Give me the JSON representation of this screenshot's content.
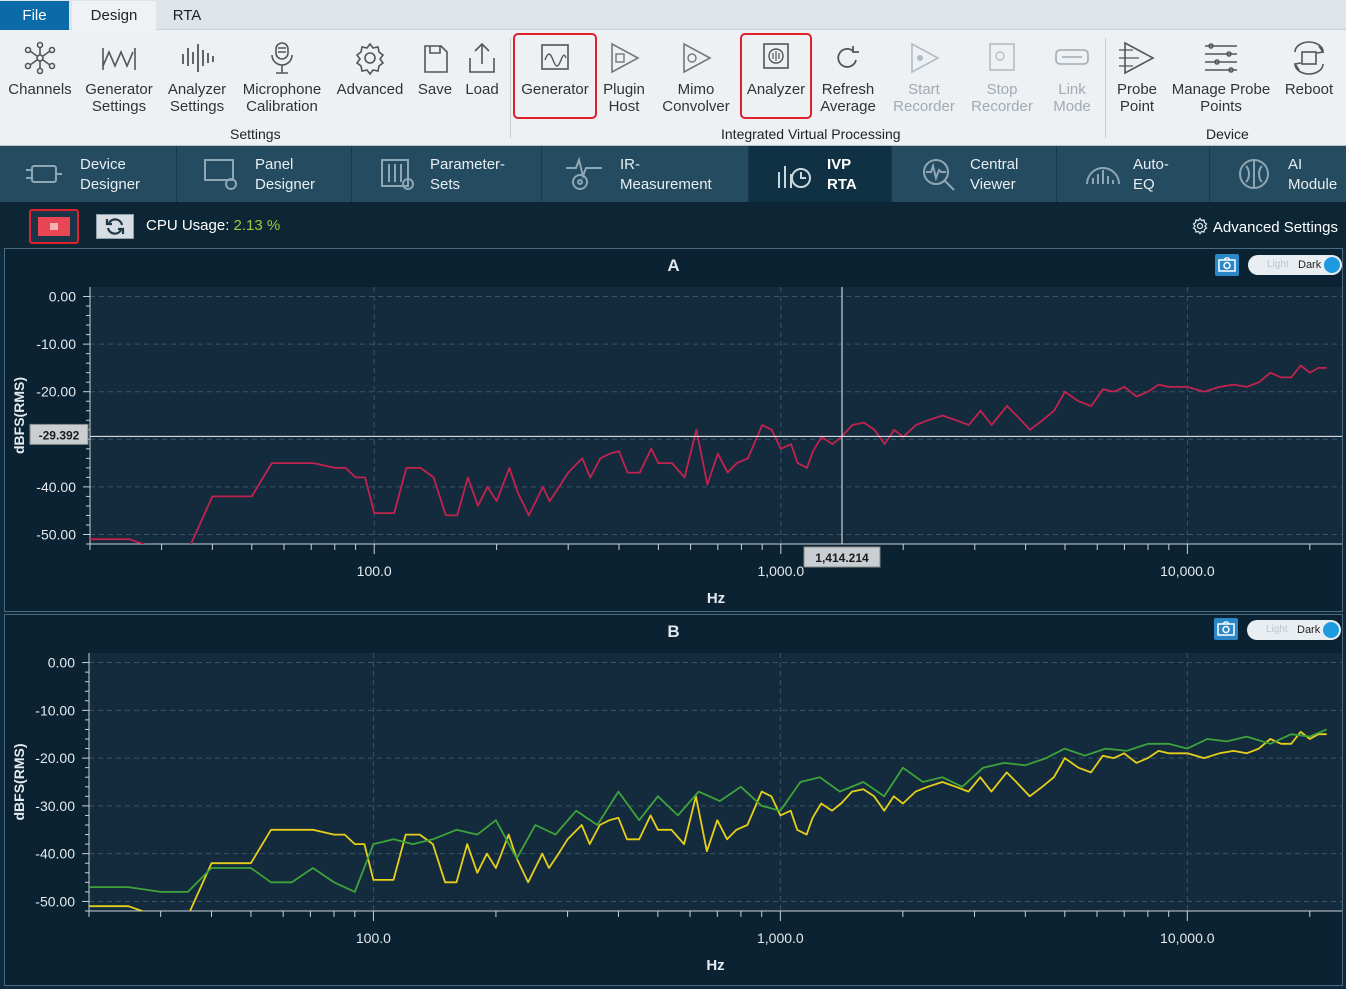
{
  "menu": {
    "tabs": [
      "File",
      "Design",
      "RTA"
    ]
  },
  "ribbon": {
    "buttons": [
      {
        "id": "channels",
        "label": "Channels"
      },
      {
        "id": "generator-settings",
        "label": "Generator\nSettings"
      },
      {
        "id": "analyzer-settings",
        "label": "Analyzer\nSettings"
      },
      {
        "id": "mic-calibration",
        "label": "Microphone\nCalibration"
      },
      {
        "id": "advanced",
        "label": "Advanced"
      },
      {
        "id": "save",
        "label": "Save"
      },
      {
        "id": "load",
        "label": "Load"
      },
      {
        "id": "generator",
        "label": "Generator"
      },
      {
        "id": "plugin-host",
        "label": "Plugin\nHost"
      },
      {
        "id": "mimo-convolver",
        "label": "Mimo\nConvolver"
      },
      {
        "id": "analyzer",
        "label": "Analyzer"
      },
      {
        "id": "refresh-average",
        "label": "Refresh\nAverage"
      },
      {
        "id": "start-recorder",
        "label": "Start\nRecorder"
      },
      {
        "id": "stop-recorder",
        "label": "Stop\nRecorder"
      },
      {
        "id": "link-mode",
        "label": "Link\nMode"
      },
      {
        "id": "probe-point",
        "label": "Probe\nPoint"
      },
      {
        "id": "manage-probe-points",
        "label": "Manage Probe\nPoints"
      },
      {
        "id": "reboot",
        "label": "Reboot"
      }
    ],
    "groups": [
      "Settings",
      "Integrated Virtual Processing",
      "Device"
    ]
  },
  "nav": {
    "tabs": [
      {
        "label": "Device\nDesigner"
      },
      {
        "label": "Panel\nDesigner"
      },
      {
        "label": "Parameter-\nSets"
      },
      {
        "label": "IR-\nMeasurement"
      },
      {
        "label": "IVP\nRTA"
      },
      {
        "label": "Central\nViewer"
      },
      {
        "label": "Auto-\nEQ"
      },
      {
        "label": "AI\nModule"
      }
    ]
  },
  "toolbar": {
    "cpu_label": "CPU Usage:",
    "cpu_value": "2.13",
    "cpu_unit": "%",
    "advanced_settings": "Advanced Settings"
  },
  "theme_toggle": {
    "light": "Light",
    "dark": "Dark"
  },
  "colors": {
    "series_a": "#c2234e",
    "series_b1": "#e6cf1a",
    "series_b2": "#3ea33a",
    "highlight": "#e0202a"
  },
  "chart_data": [
    {
      "type": "line",
      "title": "A",
      "xlabel": "Hz",
      "ylabel": "dBFS(RMS)",
      "x_scale": "log",
      "xlim": [
        20,
        24000
      ],
      "ylim": [
        -52,
        2
      ],
      "xticks": [
        "100.0",
        "1,000.0",
        "10,000.0"
      ],
      "yticks": [
        "0.00",
        "-10.00",
        "-20.00",
        "-40.00",
        "-50.00"
      ],
      "cursor": {
        "x": 1414.214,
        "x_label": "1,414.214",
        "y": -29.392,
        "y_label": "-29.392"
      },
      "series": [
        {
          "x": [
            20,
            25,
            27,
            31,
            35,
            40,
            45,
            50,
            56,
            63,
            71,
            80,
            85,
            90,
            95,
            100,
            112,
            120,
            130,
            140,
            150,
            160,
            170,
            180,
            190,
            200,
            215,
            225,
            240,
            260,
            270,
            285,
            300,
            325,
            340,
            360,
            380,
            400,
            420,
            450,
            480,
            500,
            540,
            580,
            620,
            660,
            700,
            740,
            780,
            830,
            900,
            950,
            1000,
            1060,
            1100,
            1160,
            1200,
            1260,
            1340,
            1414,
            1500,
            1600,
            1700,
            1800,
            1900,
            2000,
            2150,
            2300,
            2500,
            2700,
            2900,
            3100,
            3300,
            3600,
            3800,
            4100,
            4400,
            4700,
            5000,
            5400,
            5800,
            6200,
            6600,
            7000,
            7500,
            8000,
            8500,
            9000,
            10000,
            11000,
            12000,
            13000,
            14000,
            15000,
            16000,
            17000,
            18000,
            19000,
            20000,
            21000,
            22000
          ],
          "y": [
            -51,
            -51,
            -52,
            -55,
            -53,
            -42,
            -42,
            -42,
            -35,
            -35,
            -35,
            -36,
            -36,
            -38,
            -38,
            -45.5,
            -45.5,
            -36,
            -36,
            -38,
            -46,
            -46,
            -38,
            -44,
            -40,
            -43,
            -36,
            -41,
            -46,
            -40,
            -43,
            -40,
            -37,
            -34,
            -38,
            -34,
            -33,
            -32.5,
            -37,
            -37,
            -32,
            -35,
            -35,
            -38,
            -28,
            -39.5,
            -33,
            -37,
            -35,
            -34,
            -27,
            -28,
            -32,
            -31,
            -35,
            -36,
            -32.5,
            -29.5,
            -31,
            -29.4,
            -27,
            -26.5,
            -28,
            -31,
            -28,
            -29.5,
            -27,
            -26,
            -25,
            -26,
            -27,
            -24,
            -27,
            -23,
            -25,
            -28,
            -26,
            -24,
            -20,
            -22,
            -23,
            -19.5,
            -20,
            -19,
            -21,
            -20,
            -18.5,
            -19,
            -19,
            -20,
            -19,
            -18.5,
            -19,
            -18,
            -16,
            -17,
            -17,
            -14.5,
            -16,
            -15,
            -15
          ]
        }
      ]
    },
    {
      "type": "line",
      "title": "B",
      "xlabel": "Hz",
      "ylabel": "dBFS(RMS)",
      "x_scale": "log",
      "xlim": [
        20,
        24000
      ],
      "ylim": [
        -52,
        2
      ],
      "xticks": [
        "100.0",
        "1,000.0",
        "10,000.0"
      ],
      "yticks": [
        "0.00",
        "-10.00",
        "-20.00",
        "-30.00",
        "-40.00",
        "-50.00"
      ],
      "series": [
        {
          "x": [
            20,
            25,
            27,
            31,
            35,
            40,
            45,
            50,
            56,
            63,
            71,
            80,
            85,
            90,
            95,
            100,
            112,
            120,
            130,
            140,
            150,
            160,
            170,
            180,
            190,
            200,
            215,
            225,
            240,
            260,
            270,
            285,
            300,
            325,
            340,
            360,
            380,
            400,
            420,
            450,
            480,
            500,
            540,
            580,
            620,
            660,
            700,
            740,
            780,
            830,
            900,
            950,
            1000,
            1060,
            1100,
            1160,
            1200,
            1260,
            1340,
            1414,
            1500,
            1600,
            1700,
            1800,
            1900,
            2000,
            2150,
            2300,
            2500,
            2700,
            2900,
            3100,
            3300,
            3600,
            3800,
            4100,
            4400,
            4700,
            5000,
            5400,
            5800,
            6200,
            6600,
            7000,
            7500,
            8000,
            8500,
            9000,
            10000,
            11000,
            12000,
            13000,
            14000,
            15000,
            16000,
            17000,
            18000,
            19000,
            20000,
            21000,
            22000
          ],
          "y": [
            -51,
            -51,
            -52,
            -55,
            -53,
            -42,
            -42,
            -42,
            -35,
            -35,
            -35,
            -36,
            -36,
            -38,
            -38,
            -45.5,
            -45.5,
            -36,
            -36,
            -38,
            -46,
            -46,
            -38,
            -44,
            -40,
            -43,
            -36,
            -41,
            -46,
            -40,
            -43,
            -40,
            -37,
            -34,
            -38,
            -34,
            -33,
            -32.5,
            -37,
            -37,
            -32,
            -35,
            -35,
            -38,
            -28,
            -39.5,
            -33,
            -37,
            -35,
            -34,
            -27,
            -28,
            -32,
            -31,
            -35,
            -36,
            -32.5,
            -29.5,
            -31,
            -29.4,
            -27,
            -26.5,
            -28,
            -31,
            -28,
            -29.5,
            -27,
            -26,
            -25,
            -26,
            -27,
            -24,
            -27,
            -23,
            -25,
            -28,
            -26,
            -24,
            -20,
            -22,
            -23,
            -19.5,
            -20,
            -19,
            -21,
            -20,
            -18.5,
            -19,
            -19,
            -20,
            -19,
            -18.5,
            -19,
            -18,
            -16,
            -17,
            -17,
            -14.5,
            -16,
            -15,
            -15
          ]
        },
        {
          "x": [
            20,
            25,
            30,
            35,
            40,
            45,
            50,
            56,
            63,
            71,
            80,
            90,
            100,
            112,
            125,
            140,
            160,
            180,
            200,
            225,
            250,
            280,
            315,
            355,
            400,
            450,
            500,
            560,
            630,
            710,
            800,
            900,
            1000,
            1120,
            1250,
            1400,
            1600,
            1800,
            2000,
            2240,
            2500,
            2800,
            3150,
            3550,
            4000,
            4500,
            5000,
            5600,
            6300,
            7100,
            8000,
            9000,
            10000,
            11200,
            12500,
            14000,
            16000,
            18000,
            20000,
            22000
          ],
          "y": [
            -47,
            -47,
            -48,
            -48,
            -43,
            -43,
            -43,
            -46,
            -46,
            -43,
            -46,
            -48,
            -38,
            -37,
            -38,
            -37,
            -35,
            -36,
            -33,
            -41,
            -34,
            -36,
            -31,
            -34,
            -27,
            -33,
            -28,
            -32,
            -27,
            -29,
            -26,
            -30,
            -31,
            -25,
            -24,
            -27,
            -25,
            -28,
            -22,
            -25,
            -24,
            -26,
            -22,
            -21,
            -21.5,
            -20,
            -18,
            -19.5,
            -18,
            -18.5,
            -17,
            -17,
            -18,
            -16,
            -16.5,
            -15.5,
            -17,
            -15,
            -15.5,
            -14
          ]
        }
      ]
    }
  ]
}
